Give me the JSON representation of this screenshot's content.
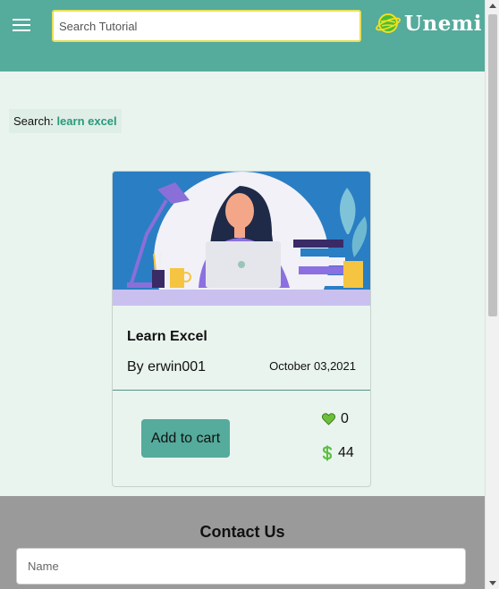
{
  "header": {
    "menu_icon": "hamburger-menu-icon",
    "search_placeholder": "Search Tutorial",
    "logo_text": "Unemi",
    "logo_icon": "planet-ring-icon"
  },
  "search_result": {
    "prefix": "Search:",
    "term": "learn excel"
  },
  "card": {
    "image": "woman-working-at-laptop-illustration",
    "title": "Learn Excel",
    "author": "By erwin001",
    "date": "October 03,2021",
    "add_to_cart_label": "Add to cart",
    "likes_icon": "heart-icon",
    "likes": "0",
    "price_icon": "dollar-icon",
    "price": "44"
  },
  "footer": {
    "contact_title": "Contact Us",
    "name_placeholder": "Name"
  },
  "colors": {
    "header_bg": "#55ab9c",
    "page_bg": "#eaf4ef",
    "accent_text": "#279a7a",
    "footer_bg": "#9a9a9a",
    "search_border": "#e8e05a"
  }
}
